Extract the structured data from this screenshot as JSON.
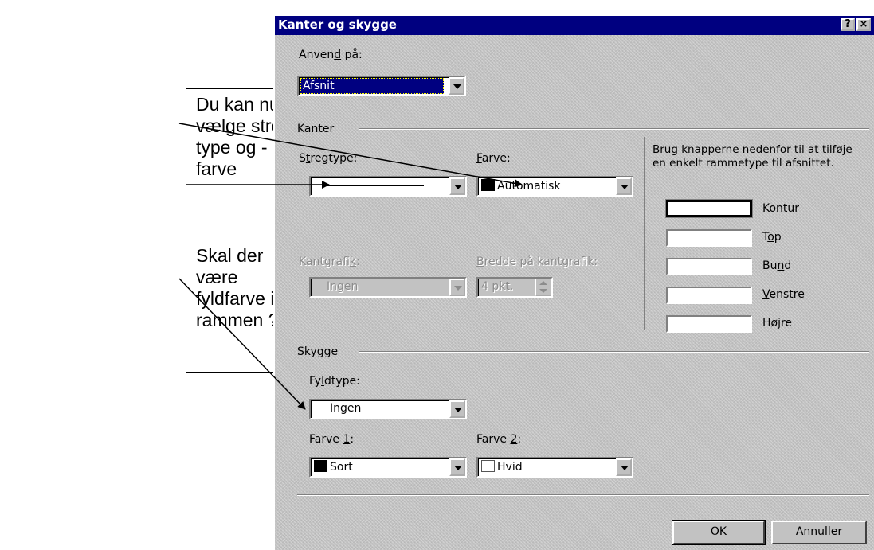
{
  "callouts": {
    "first": "Du kan nu\nvælge streg\ntype og -\nfarve",
    "second": "Skal der\nvære\nfyldfarve i\nrammen ?"
  },
  "dialog": {
    "title": "Kanter og skygge",
    "help_button": "?",
    "close_button": "×",
    "apply_to": {
      "label_a": "Anven",
      "label_key": "d",
      "label_b": " på:",
      "value": "Afsnit"
    },
    "borders": {
      "group_label": "Kanter",
      "line_type": {
        "label_a": "S",
        "label_key": "t",
        "label_b": "regtype:"
      },
      "color": {
        "label_key": "F",
        "label_b": "arve:",
        "value": "Automatisk"
      },
      "border_art": {
        "label_a": "Kantgrafi",
        "label_key": "k",
        "label_b": ":",
        "value": "Ingen"
      },
      "art_width": {
        "label_key": "B",
        "label_b": "redde på kantgrafik:",
        "value": "4 pkt."
      },
      "hint": "Brug knapperne nedenfor til at tilføje en enkelt rammetype til afsnittet.",
      "buttons": [
        {
          "a": "Kont",
          "key": "u",
          "b": "r"
        },
        {
          "a": "T",
          "key": "o",
          "b": "p"
        },
        {
          "a": "Bu",
          "key": "n",
          "b": "d"
        },
        {
          "a": "",
          "key": "V",
          "b": "enstre"
        },
        {
          "a": "Hø",
          "key": "j",
          "b": "re"
        }
      ]
    },
    "shading": {
      "group_label": "Skygge",
      "fill_type": {
        "label_a": "Fy",
        "label_key": "l",
        "label_b": "dtype:",
        "value": "Ingen"
      },
      "color1": {
        "label_a": "Farve ",
        "label_key": "1",
        "label_b": ":",
        "value": "Sort",
        "swatch": "#000000"
      },
      "color2": {
        "label_a": "Farve ",
        "label_key": "2",
        "label_b": ":",
        "value": "Hvid",
        "swatch": "#ffffff"
      }
    },
    "ok": "OK",
    "cancel": "Annuller"
  }
}
